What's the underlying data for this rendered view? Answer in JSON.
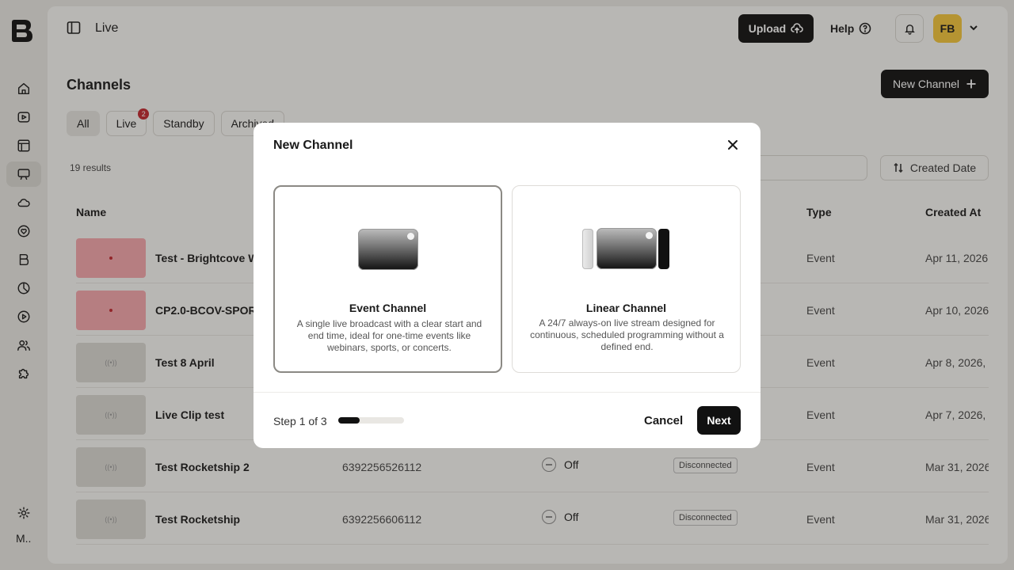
{
  "topbar": {
    "page_label": "Live",
    "upload_label": "Upload",
    "help_label": "Help",
    "avatar_initials": "FB"
  },
  "rail": {
    "user_initial": "M.."
  },
  "page": {
    "title": "Channels",
    "new_channel_label": "New Channel",
    "results": "19 results",
    "sort_label": "Created Date"
  },
  "filters": [
    {
      "label": "All"
    },
    {
      "label": "Live",
      "badge": "2"
    },
    {
      "label": "Standby"
    },
    {
      "label": "Archived"
    }
  ],
  "table": {
    "headers": {
      "name": "Name",
      "type": "Type",
      "created": "Created At"
    },
    "rows": [
      {
        "name": "Test - Brightcove W",
        "id": "",
        "state": "",
        "conn": "",
        "type": "Event",
        "created": "Apr 11, 2026,",
        "live": true
      },
      {
        "name": "CP2.0-BCOV-SPOR",
        "id": "",
        "state": "",
        "conn": "",
        "type": "Event",
        "created": "Apr 10, 2026",
        "live": true
      },
      {
        "name": "Test 8 April",
        "id": "",
        "state": "",
        "conn": "",
        "type": "Event",
        "created": "Apr 8, 2026,",
        "live": false
      },
      {
        "name": "Live Clip test",
        "id": "",
        "state": "",
        "conn": "",
        "type": "Event",
        "created": "Apr 7, 2026,",
        "live": false
      },
      {
        "name": "Test Rocketship 2",
        "id": "6392256526112",
        "state": "Off",
        "conn": "Disconnected",
        "type": "Event",
        "created": "Mar 31, 2026",
        "live": false
      },
      {
        "name": "Test Rocketship",
        "id": "6392256606112",
        "state": "Off",
        "conn": "Disconnected",
        "type": "Event",
        "created": "Mar 31, 2026",
        "live": false
      }
    ]
  },
  "modal": {
    "title": "New Channel",
    "options": [
      {
        "title": "Event Channel",
        "description": "A single live broadcast with a clear start and end time, ideal for one-time events like webinars, sports, or concerts."
      },
      {
        "title": "Linear Channel",
        "description": "A 24/7 always-on live stream designed for continuous, scheduled programming without a defined end."
      }
    ],
    "step_text": "Step 1 of 3",
    "step_progress": 0.33,
    "cancel_label": "Cancel",
    "next_label": "Next"
  }
}
